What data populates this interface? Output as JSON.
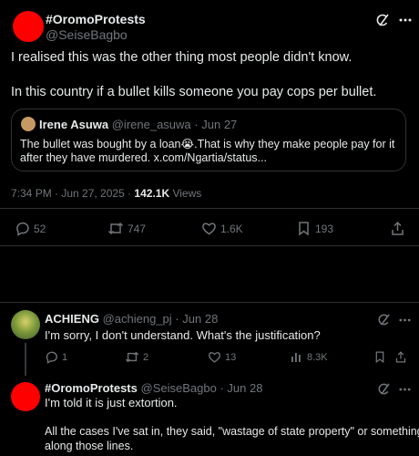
{
  "main_post": {
    "display_name": "#OromoProtests",
    "handle": "@SeiseBagbo",
    "body_line1": "I realised this was the other thing most people didn't know.",
    "body_line2": "In this country if a bullet kills someone you pay cops per bullet.",
    "quote": {
      "display_name": "Irene Asuwa",
      "handle": "@irene_asuwa",
      "separator": "·",
      "date": "Jun 27",
      "line1": "The bullet was bought by a loan😭.That is why they make people pay for it",
      "line2": "after they have murdered. x.com/Ngartia/status..."
    },
    "timestamp": "7:34 PM · Jun 27, 2025 · ",
    "views_count": "142.1K",
    "views_label": " Views",
    "actions": {
      "replies": "52",
      "reposts": "747",
      "likes": "1.6K",
      "bookmarks": "193"
    }
  },
  "reply1": {
    "display_name": "ACHIENG",
    "handle": "@achieng_pj",
    "separator": "·",
    "date": "Jun 28",
    "body": "I'm sorry, I don't understand. What's the justification?",
    "actions": {
      "replies": "1",
      "reposts": "2",
      "likes": "13",
      "views": "8.3K"
    }
  },
  "reply2": {
    "display_name": "#OromoProtests",
    "handle": "@SeiseBagbo",
    "separator": "·",
    "date": "Jun 28",
    "body_line1": "I'm told it is just extortion.",
    "body_line2": "All the cases I've sat in, they said, \"wastage of state property\" or something",
    "body_line3": "along those lines."
  },
  "colors": {
    "background": "#000000",
    "text": "#e7e9ea",
    "muted": "#71767b",
    "avatar_red": "#ff0000",
    "divider": "#2f3336"
  },
  "icons": [
    "grok-icon",
    "reply-icon",
    "repost-icon",
    "like-icon",
    "bookmark-icon",
    "share-icon",
    "views-icon"
  ]
}
